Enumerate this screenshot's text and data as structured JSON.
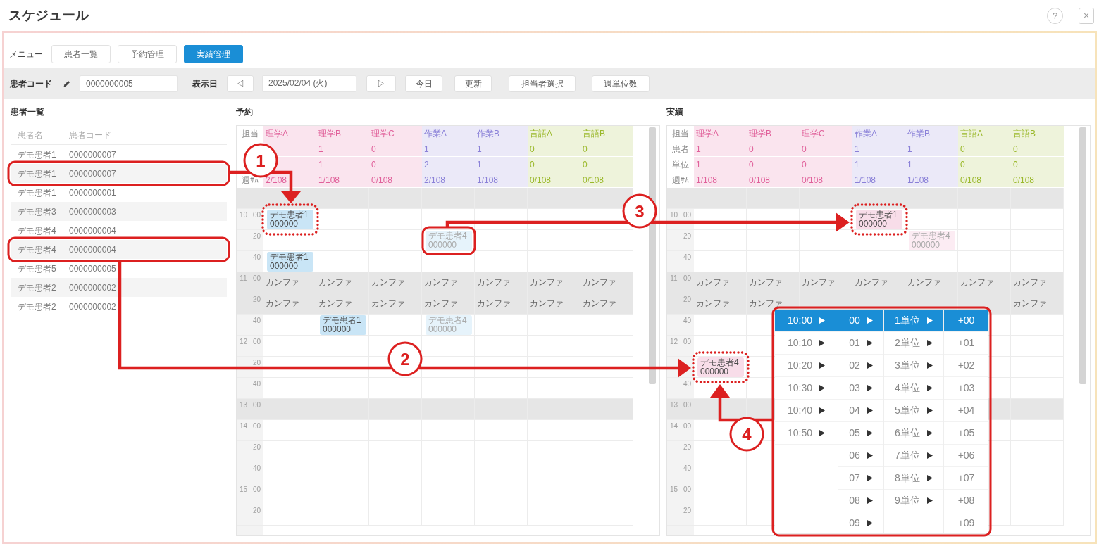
{
  "window": {
    "title": "スケジュール",
    "help_button": "?",
    "close_button": "×"
  },
  "menu": {
    "label": "メニュー",
    "items": [
      {
        "label": "患者一覧",
        "selected": false
      },
      {
        "label": "予約管理",
        "selected": false
      },
      {
        "label": "実績管理",
        "selected": true
      }
    ]
  },
  "toolbar": {
    "patient_code_label": "患者コード",
    "patient_code": "0000000005",
    "date_label": "表示日",
    "prev_button": "◁",
    "date": "2025/02/04 (火)",
    "next_button": "▷",
    "buttons": [
      "今日",
      "更新",
      "担当者選択",
      "週単位数"
    ]
  },
  "patients": {
    "title": "患者一覧",
    "columns": [
      "患者名",
      "患者コード"
    ],
    "rows": [
      {
        "name": "デモ患者1",
        "code": "0000000007",
        "marked": false
      },
      {
        "name": "デモ患者1",
        "code": "0000000007",
        "marked": true
      },
      {
        "name": "デモ患者1",
        "code": "0000000001",
        "marked": false
      },
      {
        "name": "デモ患者3",
        "code": "0000000003",
        "marked": false
      },
      {
        "name": "デモ患者4",
        "code": "0000000004",
        "marked": false
      },
      {
        "name": "デモ患者4",
        "code": "0000000004",
        "marked": true
      },
      {
        "name": "デモ患者5",
        "code": "0000000005",
        "marked": false
      },
      {
        "name": "デモ患者2",
        "code": "0000000002",
        "marked": false
      },
      {
        "name": "デモ患者2",
        "code": "0000000002",
        "marked": false
      }
    ]
  },
  "reservations": {
    "title": "予約",
    "header_label": "担当",
    "columns": [
      {
        "name": "理学A",
        "color": "#e0609a"
      },
      {
        "name": "理学B",
        "color": "#e0609a"
      },
      {
        "name": "理学C",
        "color": "#e0609a"
      },
      {
        "name": "作業A",
        "color": "#8a80d8"
      },
      {
        "name": "作業B",
        "color": "#8a80d8"
      },
      {
        "name": "言語A",
        "color": "#9ab82a"
      },
      {
        "name": "言語B",
        "color": "#9ab82a"
      }
    ],
    "summary_rows": [
      {
        "cells": [
          null,
          "1",
          "0",
          "1",
          "1",
          "0",
          "0"
        ]
      },
      {
        "cells": [
          null,
          "1",
          "0",
          "2",
          "1",
          "0",
          "0"
        ]
      },
      {
        "label": "週ｻﾑ",
        "cells": [
          "2/108",
          "1/108",
          "0/108",
          "2/108",
          "1/108",
          "0/108",
          "0/108"
        ]
      }
    ],
    "rows": [
      {
        "shaded": true
      },
      {
        "hour": "10",
        "minute": "00",
        "shaded": false,
        "cells": [
          {
            "lines": [
              "デモ患者1",
              "000000"
            ],
            "color": "#c9e5f6",
            "faded": false,
            "marked": true,
            "dotted": true
          },
          null,
          null,
          null,
          null,
          null,
          null
        ]
      },
      {
        "minute": "20",
        "shaded": false,
        "cells": [
          null,
          null,
          null,
          {
            "lines": [
              "デモ患者4",
              "000000"
            ],
            "color": "#e6f3fb",
            "faded": true,
            "marked": true,
            "dotted": false
          },
          null,
          null,
          null
        ]
      },
      {
        "minute": "40",
        "shaded": false,
        "cells": [
          {
            "lines": [
              "デモ患者1",
              "000000"
            ],
            "color": "#c9e5f6",
            "faded": false,
            "marked": false
          },
          null,
          null,
          null,
          null,
          null,
          null
        ]
      },
      {
        "hour": "11",
        "minute": "00",
        "shaded": true,
        "cells": [
          "カンファ",
          "カンファ",
          "カンファ",
          "カンファ",
          "カンファ",
          "カンファ",
          "カンファ"
        ]
      },
      {
        "minute": "20",
        "shaded": true,
        "cells": [
          "カンファ",
          "カンファ",
          "カンファ",
          "カンファ",
          "カンファ",
          "カンファ",
          "カンファ"
        ]
      },
      {
        "minute": "40",
        "shaded": false,
        "cells": [
          null,
          {
            "lines": [
              "デモ患者1",
              "000000"
            ],
            "color": "#c9e5f6",
            "faded": false,
            "marked": false
          },
          null,
          {
            "lines": [
              "デモ患者4",
              "000000"
            ],
            "color": "#e6f3fb",
            "faded": true,
            "marked": false
          },
          null,
          null,
          null
        ]
      },
      {
        "hour": "12",
        "minute": "00",
        "shaded": false
      },
      {
        "minute": "20",
        "shaded": false
      },
      {
        "minute": "40",
        "shaded": false
      },
      {
        "hour": "13",
        "minute": "00",
        "shaded": true
      },
      {
        "hour": "14",
        "minute": "00",
        "shaded": false
      },
      {
        "minute": "20",
        "shaded": false
      },
      {
        "minute": "40",
        "shaded": false
      },
      {
        "hour": "15",
        "minute": "00",
        "shaded": false
      },
      {
        "minute": "20",
        "shaded": false
      }
    ]
  },
  "actuals": {
    "title": "実績",
    "header_label": "担当",
    "columns": [
      {
        "name": "理学A",
        "color": "#e0609a"
      },
      {
        "name": "理学B",
        "color": "#e0609a"
      },
      {
        "name": "理学C",
        "color": "#e0609a"
      },
      {
        "name": "作業A",
        "color": "#8a80d8"
      },
      {
        "name": "作業B",
        "color": "#8a80d8"
      },
      {
        "name": "言語A",
        "color": "#9ab82a"
      },
      {
        "name": "言語B",
        "color": "#9ab82a"
      }
    ],
    "summary_rows": [
      {
        "label": "患者",
        "cells": [
          "1",
          "0",
          "0",
          "1",
          "1",
          "0",
          "0"
        ]
      },
      {
        "label": "単位",
        "cells": [
          "1",
          "0",
          "0",
          "1",
          "1",
          "0",
          "0"
        ]
      },
      {
        "label": "週ｻﾑ",
        "cells": [
          "1/108",
          "0/108",
          "0/108",
          "1/108",
          "1/108",
          "0/108",
          "0/108"
        ]
      }
    ],
    "rows": [
      {
        "shaded": true
      },
      {
        "hour": "10",
        "minute": "00",
        "shaded": false,
        "cells": [
          null,
          null,
          null,
          {
            "lines": [
              "デモ患者1",
              "000000"
            ],
            "color": "#f8dde9",
            "faded": false,
            "marked": true,
            "dotted": true
          },
          null,
          null,
          null
        ]
      },
      {
        "minute": "20",
        "shaded": false,
        "cells": [
          null,
          null,
          null,
          null,
          {
            "lines": [
              "デモ患者4",
              "000000"
            ],
            "color": "#fcecf3",
            "faded": true,
            "marked": false
          },
          null,
          null
        ]
      },
      {
        "minute": "40",
        "shaded": false
      },
      {
        "hour": "11",
        "minute": "00",
        "shaded": true,
        "cells": [
          "カンファ",
          "カンファ",
          "カンファ",
          "カンファ",
          "カンファ",
          "カンファ",
          "カンファ"
        ]
      },
      {
        "minute": "20",
        "shaded": true,
        "cells": [
          "カンファ",
          "カンファ",
          null,
          null,
          null,
          null,
          "カンファ"
        ]
      },
      {
        "minute": "40",
        "shaded": false
      },
      {
        "hour": "12",
        "minute": "00",
        "shaded": false
      },
      {
        "shaded": false,
        "cells": [
          {
            "lines": [
              "デモ患者4",
              "000000"
            ],
            "color": "#f8dde9",
            "faded": false,
            "marked": true,
            "dotted": true
          },
          null,
          null,
          null,
          null,
          null,
          null
        ]
      },
      {
        "minute": "40",
        "shaded": false
      },
      {
        "hour": "13",
        "minute": "00",
        "shaded": true
      },
      {
        "hour": "14",
        "minute": "00",
        "shaded": false
      },
      {
        "minute": "20",
        "shaded": false
      },
      {
        "minute": "40",
        "shaded": false
      },
      {
        "hour": "15",
        "minute": "00",
        "shaded": false
      },
      {
        "minute": "20",
        "shaded": false
      }
    ]
  },
  "time_menu": {
    "marked": true,
    "columns": [
      {
        "submenu": true,
        "items": [
          {
            "label": "10:00",
            "selected": true
          },
          {
            "label": "10:10",
            "selected": false
          },
          {
            "label": "10:20",
            "selected": false
          },
          {
            "label": "10:30",
            "selected": false
          },
          {
            "label": "10:40",
            "selected": false
          },
          {
            "label": "10:50",
            "selected": false
          }
        ]
      },
      {
        "submenu": true,
        "items": [
          {
            "label": "00",
            "selected": true
          },
          {
            "label": "01",
            "selected": false
          },
          {
            "label": "02",
            "selected": false
          },
          {
            "label": "03",
            "selected": false
          },
          {
            "label": "04",
            "selected": false
          },
          {
            "label": "05",
            "selected": false
          },
          {
            "label": "06",
            "selected": false
          },
          {
            "label": "07",
            "selected": false
          },
          {
            "label": "08",
            "selected": false
          },
          {
            "label": "09",
            "selected": false
          }
        ]
      },
      {
        "submenu": true,
        "items": [
          {
            "label": "1単位",
            "selected": true
          },
          {
            "label": "2単位",
            "selected": false
          },
          {
            "label": "3単位",
            "selected": false
          },
          {
            "label": "4単位",
            "selected": false
          },
          {
            "label": "5単位",
            "selected": false
          },
          {
            "label": "6単位",
            "selected": false
          },
          {
            "label": "7単位",
            "selected": false
          },
          {
            "label": "8単位",
            "selected": false
          },
          {
            "label": "9単位",
            "selected": false
          }
        ]
      },
      {
        "submenu": false,
        "items": [
          {
            "label": "+00",
            "selected": true
          },
          {
            "label": "+01",
            "selected": false
          },
          {
            "label": "+02",
            "selected": false
          },
          {
            "label": "+03",
            "selected": false
          },
          {
            "label": "+04",
            "selected": false
          },
          {
            "label": "+05",
            "selected": false
          },
          {
            "label": "+06",
            "selected": false
          },
          {
            "label": "+07",
            "selected": false
          },
          {
            "label": "+08",
            "selected": false
          },
          {
            "label": "+09",
            "selected": false
          }
        ]
      }
    ]
  },
  "annotations": [
    {
      "label": "1"
    },
    {
      "label": "2"
    },
    {
      "label": "3"
    },
    {
      "label": "4"
    }
  ]
}
